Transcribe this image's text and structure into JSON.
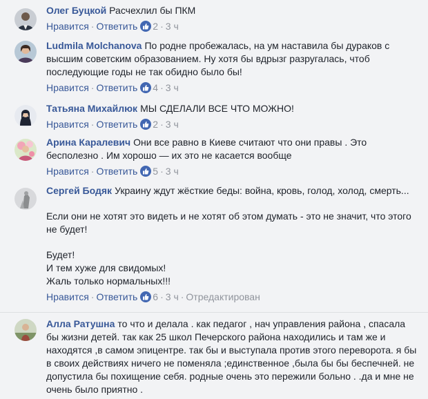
{
  "comments": [
    {
      "author": "Олег Буцкой",
      "paragraphs": [
        "Расчехлил бы ПКМ"
      ],
      "like_label": "Нравится",
      "reply_label": "Ответить",
      "likes": "2",
      "time": "3 ч",
      "edited": ""
    },
    {
      "author": "Ludmila Molchanova",
      "paragraphs": [
        "По родне пробежалась, на ум наставила бы дураков с высшим советским образованием. Ну хотя бы вдрызг разругалась, чтоб последующие годы не так обидно было бы!"
      ],
      "like_label": "Нравится",
      "reply_label": "Ответить",
      "likes": "4",
      "time": "3 ч",
      "edited": ""
    },
    {
      "author": "Татьяна Михайлюк",
      "paragraphs": [
        "МЫ СДЕЛАЛИ ВСЕ ЧТО МОЖНО!"
      ],
      "like_label": "Нравится",
      "reply_label": "Ответить",
      "likes": "2",
      "time": "3 ч",
      "edited": ""
    },
    {
      "author": "Арина Каралевич",
      "paragraphs": [
        "Они все равно в Киеве считают что они правы . Это бесполезно . Им хорошо — их это не касается вообще"
      ],
      "like_label": "Нравится",
      "reply_label": "Ответить",
      "likes": "5",
      "time": "3 ч",
      "edited": ""
    },
    {
      "author": "Сергей Бодяк",
      "paragraphs": [
        "Украину ждут жёсткие беды: война, кровь, голод, холод, смерть...",
        "Если они не хотят это видеть и не хотят об этом думать - это не значит, что этого не будет!",
        "Будет!\nИ тем хуже для свидомых!\nЖаль только нормальных!!!"
      ],
      "like_label": "Нравится",
      "reply_label": "Ответить",
      "likes": "6",
      "time": "3 ч",
      "edited": "Отредактирован"
    },
    {
      "author": "Алла Ратушна",
      "paragraphs": [
        "то что и делала . как педагог , нач управления района , спасала бы жизни детей. так как 25 школ Печерского района находились и там же и находятся ,в самом эпицентре. так бы и выступала против этого переворота. я бы в своих действиях ничего не поменяла ;единственное ,была бы бы беспечней. не допустила бы похищение себя. родные очень это пережили больно . .да и мне не очень было приятно ."
      ],
      "like_label": "",
      "reply_label": "",
      "likes": "",
      "time": "",
      "edited": ""
    }
  ],
  "colors": {
    "background": "#f2f3f5",
    "author": "#385898",
    "meta": "#90949c",
    "like_badge": "#4267b2",
    "text": "#1d2129"
  },
  "icons": {
    "like": "thumbs-up-icon"
  }
}
